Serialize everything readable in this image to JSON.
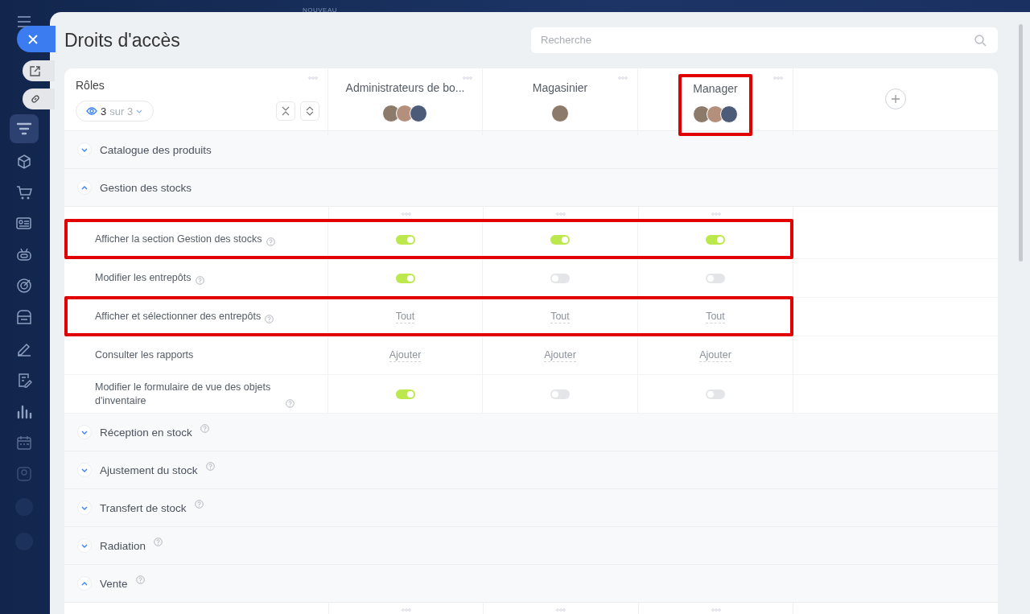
{
  "background_label": "NOUVEAU",
  "title": "Droits d'accès",
  "search": {
    "placeholder": "Recherche"
  },
  "roles_header": {
    "label": "Rôles",
    "filter_count": "3",
    "filter_total": "sur 3"
  },
  "columns": [
    {
      "name": "Administrateurs de bo...",
      "highlighted": false,
      "avatars": [
        {
          "kind": "photo"
        },
        {
          "kind": "photo"
        },
        {
          "kind": "photo"
        }
      ]
    },
    {
      "name": "Magasinier",
      "highlighted": false,
      "avatars": [
        {
          "kind": "photo"
        }
      ]
    },
    {
      "name": "Manager",
      "highlighted": true,
      "avatars": [
        {
          "kind": "photo"
        },
        {
          "kind": "photo"
        },
        {
          "kind": "photo"
        }
      ]
    }
  ],
  "sections": [
    {
      "label": "Catalogue des produits",
      "expanded": false,
      "help": false
    },
    {
      "label": "Gestion des stocks",
      "expanded": true,
      "help": false,
      "permissions": [
        {
          "label": "Afficher la section Gestion des stocks",
          "help": true,
          "highlighted": true,
          "cells": [
            {
              "kind": "toggle",
              "on": true
            },
            {
              "kind": "toggle",
              "on": true
            },
            {
              "kind": "toggle",
              "on": true
            }
          ]
        },
        {
          "label": "Modifier les entrepôts",
          "help": true,
          "highlighted": false,
          "cells": [
            {
              "kind": "toggle",
              "on": true
            },
            {
              "kind": "toggle",
              "on": false
            },
            {
              "kind": "toggle",
              "on": false
            }
          ]
        },
        {
          "label": "Afficher et sélectionner des entrepôts",
          "help": true,
          "highlighted": true,
          "cells": [
            {
              "kind": "link",
              "text": "Tout"
            },
            {
              "kind": "link",
              "text": "Tout"
            },
            {
              "kind": "link",
              "text": "Tout"
            }
          ]
        },
        {
          "label": "Consulter les rapports",
          "help": false,
          "highlighted": false,
          "cells": [
            {
              "kind": "link",
              "text": "Ajouter"
            },
            {
              "kind": "link",
              "text": "Ajouter"
            },
            {
              "kind": "link",
              "text": "Ajouter"
            }
          ]
        },
        {
          "label": "Modifier le formulaire de vue des objets d'inventaire",
          "help": true,
          "highlighted": false,
          "cells": [
            {
              "kind": "toggle",
              "on": true
            },
            {
              "kind": "toggle",
              "on": false
            },
            {
              "kind": "toggle",
              "on": false
            }
          ]
        }
      ]
    },
    {
      "label": "Réception en stock",
      "expanded": false,
      "help": true
    },
    {
      "label": "Ajustement du stock",
      "expanded": false,
      "help": true
    },
    {
      "label": "Transfert de stock",
      "expanded": false,
      "help": true
    },
    {
      "label": "Radiation",
      "expanded": false,
      "help": true
    },
    {
      "label": "Vente",
      "expanded": true,
      "help": true
    }
  ]
}
